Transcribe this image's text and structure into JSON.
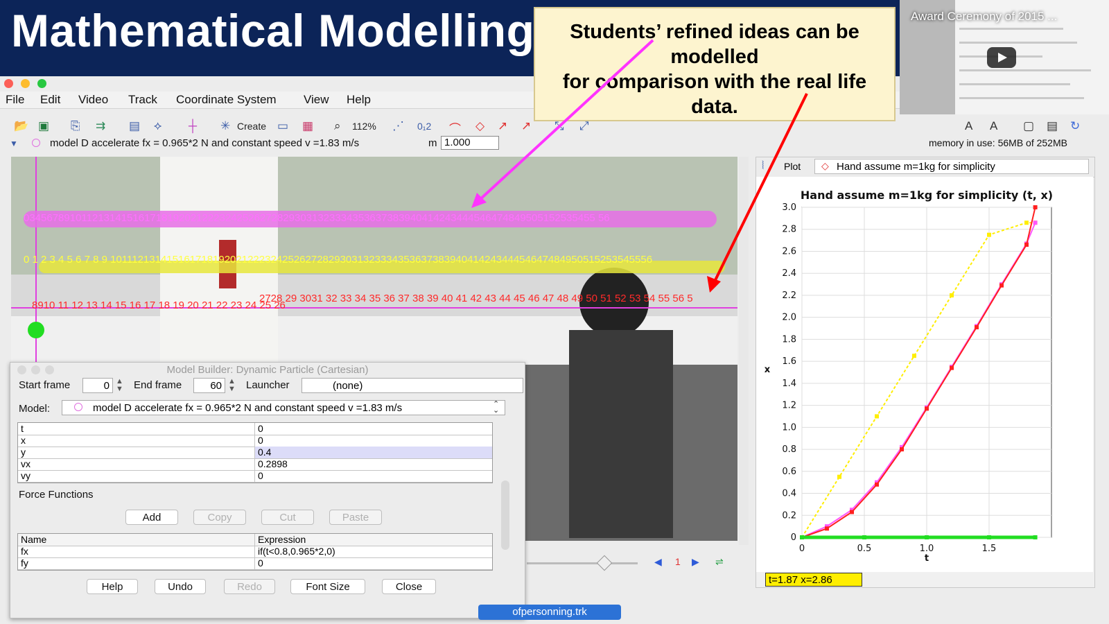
{
  "slide": {
    "title": "Mathematical Modelling",
    "callout_lines": [
      "Students’ refined  ideas can be",
      "modelled",
      "for comparison with the real life",
      "data."
    ]
  },
  "video_thumb": {
    "title": "Award Ceremony of 2015 ..."
  },
  "menu": [
    "File",
    "Edit",
    "Video",
    "Track",
    "Coordinate System",
    "View",
    "Help"
  ],
  "toolbar": {
    "create_label": "Create",
    "zoom": "112%",
    "step_label": "0₁2"
  },
  "track": {
    "model_label": "model D accelerate fx = 0.965*2 N and constant speed v =1.83 m/s",
    "mass_prefix": "m",
    "mass_value": "1.000",
    "memory": "memory in use: 56MB of 252MB"
  },
  "plot": {
    "tab_label": "Plot",
    "track_selector": "Hand assume m=1kg for simplicity",
    "readout": "t=1.87  x=2.86"
  },
  "video_player": {
    "frame_number": "1"
  },
  "chart_data": {
    "type": "scatter",
    "title": "Hand assume m=1kg for simplicity (t, x)",
    "xlabel": "t",
    "ylabel": "x",
    "xlim": [
      0,
      2.0
    ],
    "ylim": [
      0,
      3.0
    ],
    "xticks": [
      "0",
      "0.5",
      "1.0",
      "1.5"
    ],
    "yticks": [
      "0",
      "0.2",
      "0.4",
      "0.6",
      "0.8",
      "1.0",
      "1.2",
      "1.4",
      "1.6",
      "1.8",
      "2.0",
      "2.2",
      "2.4",
      "2.6",
      "2.8",
      "3.0"
    ],
    "grid": true,
    "series": [
      {
        "color": "#ffee00",
        "x": [
          0,
          0.3,
          0.6,
          0.9,
          1.2,
          1.5,
          1.8,
          1.87
        ],
        "y": [
          0,
          0.55,
          1.1,
          1.65,
          2.2,
          2.75,
          2.86,
          2.86
        ]
      },
      {
        "color": "#ff55ff",
        "x": [
          0,
          0.2,
          0.4,
          0.6,
          0.8,
          1.0,
          1.2,
          1.4,
          1.6,
          1.8,
          1.87
        ],
        "y": [
          0,
          0.1,
          0.25,
          0.5,
          0.82,
          1.18,
          1.55,
          1.92,
          2.3,
          2.67,
          2.86
        ]
      },
      {
        "color": "#ff2020",
        "x": [
          0,
          0.2,
          0.4,
          0.6,
          0.8,
          1.0,
          1.2,
          1.4,
          1.6,
          1.8,
          1.87
        ],
        "y": [
          0,
          0.08,
          0.23,
          0.48,
          0.8,
          1.17,
          1.54,
          1.91,
          2.29,
          2.66,
          3.0
        ]
      },
      {
        "color": "#22dd22",
        "x": [
          0,
          0.5,
          1.0,
          1.5,
          1.87
        ],
        "y": [
          0,
          0,
          0,
          0,
          0
        ]
      }
    ]
  },
  "video_labels": {
    "magenta_row": "034567891011213141516171819202122232425262728293031323334353637383940414243444546474849505152535455 56",
    "yellow_row": "0 1 2 3 4 5 6 7 8 9 1011121314151617181920212223242526272829303132333435363738394041424344454647484950515253545556",
    "red_row_a": "2728 29 3031 32 33 34 35 36 37 38 39 40 41 42 43 44 45 46 47 48 49 50 51 52 53 54 55 56 5",
    "red_row_b": "8910 11 12 13 14 15 16 17 18 19 20 21 22 23 24 25 26"
  },
  "model_builder": {
    "title": "Model Builder: Dynamic Particle (Cartesian)",
    "start_frame_label": "Start frame",
    "start_frame": "0",
    "end_frame_label": "End frame",
    "end_frame": "60",
    "launcher_label": "Launcher",
    "launcher_value": "(none)",
    "model_label": "Model:",
    "model_value": "model D accelerate fx = 0.965*2 N and constant speed v =1.83 m/s",
    "params": [
      {
        "name": "t",
        "value": "0"
      },
      {
        "name": "x",
        "value": "0"
      },
      {
        "name": "y",
        "value": "0.4"
      },
      {
        "name": "vx",
        "value": "0.2898"
      },
      {
        "name": "vy",
        "value": "0"
      }
    ],
    "force_functions_label": "Force Functions",
    "force_buttons": [
      "Add",
      "Copy",
      "Cut",
      "Paste"
    ],
    "force_headers": [
      "Name",
      "Expression"
    ],
    "forces": [
      {
        "name": "fx",
        "expr": "if(t<0.8,0.965*2,0)"
      },
      {
        "name": "fy",
        "expr": "0"
      }
    ],
    "bottom_buttons": [
      "Help",
      "Undo",
      "Redo",
      "Font Size",
      "Close"
    ]
  },
  "taskbar": {
    "file_tab": "ofpersonning.trk"
  }
}
